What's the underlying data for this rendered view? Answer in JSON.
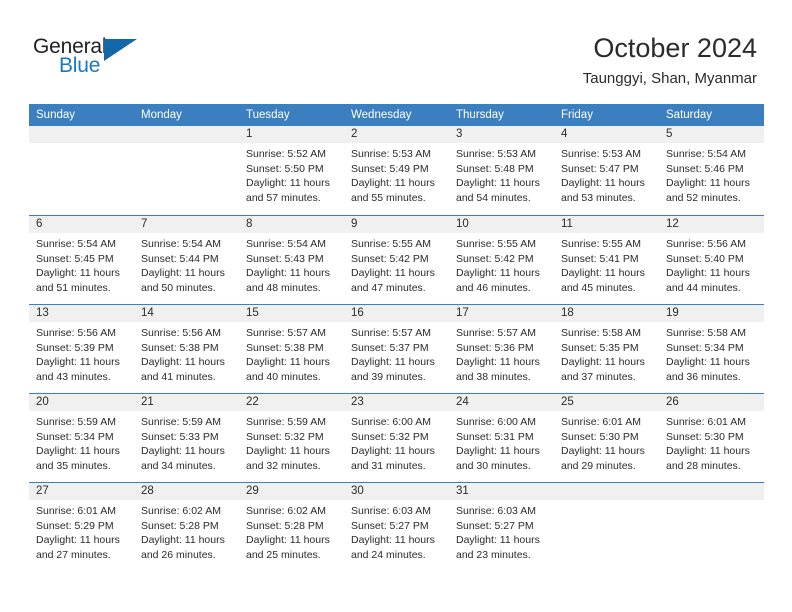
{
  "brand": {
    "word1": "General",
    "word2": "Blue",
    "icon": "triangle-logo"
  },
  "header": {
    "title": "October 2024",
    "location": "Taunggyi, Shan, Myanmar"
  },
  "colors": {
    "header_blue": "#3b7fc0",
    "brand_blue": "#1b79c4",
    "daynum_gray": "#f0f0f0",
    "text": "#2b2b2b"
  },
  "weekdays": [
    "Sunday",
    "Monday",
    "Tuesday",
    "Wednesday",
    "Thursday",
    "Friday",
    "Saturday"
  ],
  "labels": {
    "sunrise": "Sunrise:",
    "sunset": "Sunset:",
    "daylight": "Daylight:"
  },
  "weeks": [
    [
      {
        "day": "",
        "sunrise": "",
        "sunset": "",
        "daylight1": "",
        "daylight2": ""
      },
      {
        "day": "",
        "sunrise": "",
        "sunset": "",
        "daylight1": "",
        "daylight2": ""
      },
      {
        "day": "1",
        "sunrise": "Sunrise: 5:52 AM",
        "sunset": "Sunset: 5:50 PM",
        "daylight1": "Daylight: 11 hours",
        "daylight2": "and 57 minutes."
      },
      {
        "day": "2",
        "sunrise": "Sunrise: 5:53 AM",
        "sunset": "Sunset: 5:49 PM",
        "daylight1": "Daylight: 11 hours",
        "daylight2": "and 55 minutes."
      },
      {
        "day": "3",
        "sunrise": "Sunrise: 5:53 AM",
        "sunset": "Sunset: 5:48 PM",
        "daylight1": "Daylight: 11 hours",
        "daylight2": "and 54 minutes."
      },
      {
        "day": "4",
        "sunrise": "Sunrise: 5:53 AM",
        "sunset": "Sunset: 5:47 PM",
        "daylight1": "Daylight: 11 hours",
        "daylight2": "and 53 minutes."
      },
      {
        "day": "5",
        "sunrise": "Sunrise: 5:54 AM",
        "sunset": "Sunset: 5:46 PM",
        "daylight1": "Daylight: 11 hours",
        "daylight2": "and 52 minutes."
      }
    ],
    [
      {
        "day": "6",
        "sunrise": "Sunrise: 5:54 AM",
        "sunset": "Sunset: 5:45 PM",
        "daylight1": "Daylight: 11 hours",
        "daylight2": "and 51 minutes."
      },
      {
        "day": "7",
        "sunrise": "Sunrise: 5:54 AM",
        "sunset": "Sunset: 5:44 PM",
        "daylight1": "Daylight: 11 hours",
        "daylight2": "and 50 minutes."
      },
      {
        "day": "8",
        "sunrise": "Sunrise: 5:54 AM",
        "sunset": "Sunset: 5:43 PM",
        "daylight1": "Daylight: 11 hours",
        "daylight2": "and 48 minutes."
      },
      {
        "day": "9",
        "sunrise": "Sunrise: 5:55 AM",
        "sunset": "Sunset: 5:42 PM",
        "daylight1": "Daylight: 11 hours",
        "daylight2": "and 47 minutes."
      },
      {
        "day": "10",
        "sunrise": "Sunrise: 5:55 AM",
        "sunset": "Sunset: 5:42 PM",
        "daylight1": "Daylight: 11 hours",
        "daylight2": "and 46 minutes."
      },
      {
        "day": "11",
        "sunrise": "Sunrise: 5:55 AM",
        "sunset": "Sunset: 5:41 PM",
        "daylight1": "Daylight: 11 hours",
        "daylight2": "and 45 minutes."
      },
      {
        "day": "12",
        "sunrise": "Sunrise: 5:56 AM",
        "sunset": "Sunset: 5:40 PM",
        "daylight1": "Daylight: 11 hours",
        "daylight2": "and 44 minutes."
      }
    ],
    [
      {
        "day": "13",
        "sunrise": "Sunrise: 5:56 AM",
        "sunset": "Sunset: 5:39 PM",
        "daylight1": "Daylight: 11 hours",
        "daylight2": "and 43 minutes."
      },
      {
        "day": "14",
        "sunrise": "Sunrise: 5:56 AM",
        "sunset": "Sunset: 5:38 PM",
        "daylight1": "Daylight: 11 hours",
        "daylight2": "and 41 minutes."
      },
      {
        "day": "15",
        "sunrise": "Sunrise: 5:57 AM",
        "sunset": "Sunset: 5:38 PM",
        "daylight1": "Daylight: 11 hours",
        "daylight2": "and 40 minutes."
      },
      {
        "day": "16",
        "sunrise": "Sunrise: 5:57 AM",
        "sunset": "Sunset: 5:37 PM",
        "daylight1": "Daylight: 11 hours",
        "daylight2": "and 39 minutes."
      },
      {
        "day": "17",
        "sunrise": "Sunrise: 5:57 AM",
        "sunset": "Sunset: 5:36 PM",
        "daylight1": "Daylight: 11 hours",
        "daylight2": "and 38 minutes."
      },
      {
        "day": "18",
        "sunrise": "Sunrise: 5:58 AM",
        "sunset": "Sunset: 5:35 PM",
        "daylight1": "Daylight: 11 hours",
        "daylight2": "and 37 minutes."
      },
      {
        "day": "19",
        "sunrise": "Sunrise: 5:58 AM",
        "sunset": "Sunset: 5:34 PM",
        "daylight1": "Daylight: 11 hours",
        "daylight2": "and 36 minutes."
      }
    ],
    [
      {
        "day": "20",
        "sunrise": "Sunrise: 5:59 AM",
        "sunset": "Sunset: 5:34 PM",
        "daylight1": "Daylight: 11 hours",
        "daylight2": "and 35 minutes."
      },
      {
        "day": "21",
        "sunrise": "Sunrise: 5:59 AM",
        "sunset": "Sunset: 5:33 PM",
        "daylight1": "Daylight: 11 hours",
        "daylight2": "and 34 minutes."
      },
      {
        "day": "22",
        "sunrise": "Sunrise: 5:59 AM",
        "sunset": "Sunset: 5:32 PM",
        "daylight1": "Daylight: 11 hours",
        "daylight2": "and 32 minutes."
      },
      {
        "day": "23",
        "sunrise": "Sunrise: 6:00 AM",
        "sunset": "Sunset: 5:32 PM",
        "daylight1": "Daylight: 11 hours",
        "daylight2": "and 31 minutes."
      },
      {
        "day": "24",
        "sunrise": "Sunrise: 6:00 AM",
        "sunset": "Sunset: 5:31 PM",
        "daylight1": "Daylight: 11 hours",
        "daylight2": "and 30 minutes."
      },
      {
        "day": "25",
        "sunrise": "Sunrise: 6:01 AM",
        "sunset": "Sunset: 5:30 PM",
        "daylight1": "Daylight: 11 hours",
        "daylight2": "and 29 minutes."
      },
      {
        "day": "26",
        "sunrise": "Sunrise: 6:01 AM",
        "sunset": "Sunset: 5:30 PM",
        "daylight1": "Daylight: 11 hours",
        "daylight2": "and 28 minutes."
      }
    ],
    [
      {
        "day": "27",
        "sunrise": "Sunrise: 6:01 AM",
        "sunset": "Sunset: 5:29 PM",
        "daylight1": "Daylight: 11 hours",
        "daylight2": "and 27 minutes."
      },
      {
        "day": "28",
        "sunrise": "Sunrise: 6:02 AM",
        "sunset": "Sunset: 5:28 PM",
        "daylight1": "Daylight: 11 hours",
        "daylight2": "and 26 minutes."
      },
      {
        "day": "29",
        "sunrise": "Sunrise: 6:02 AM",
        "sunset": "Sunset: 5:28 PM",
        "daylight1": "Daylight: 11 hours",
        "daylight2": "and 25 minutes."
      },
      {
        "day": "30",
        "sunrise": "Sunrise: 6:03 AM",
        "sunset": "Sunset: 5:27 PM",
        "daylight1": "Daylight: 11 hours",
        "daylight2": "and 24 minutes."
      },
      {
        "day": "31",
        "sunrise": "Sunrise: 6:03 AM",
        "sunset": "Sunset: 5:27 PM",
        "daylight1": "Daylight: 11 hours",
        "daylight2": "and 23 minutes."
      },
      {
        "day": "",
        "sunrise": "",
        "sunset": "",
        "daylight1": "",
        "daylight2": ""
      },
      {
        "day": "",
        "sunrise": "",
        "sunset": "",
        "daylight1": "",
        "daylight2": ""
      }
    ]
  ]
}
